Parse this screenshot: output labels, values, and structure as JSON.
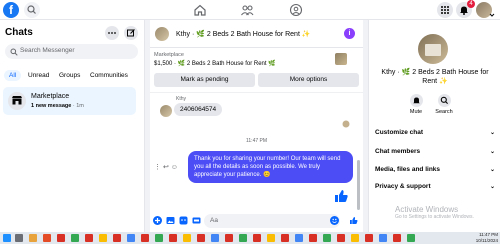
{
  "topbar": {
    "logo_letter": "f",
    "notification_count": "4"
  },
  "sidebar": {
    "title": "Chats",
    "search_placeholder": "Search Messenger",
    "filters": [
      "All",
      "Unread",
      "Groups",
      "Communities"
    ],
    "chat_item": {
      "name": "Marketplace",
      "preview": "1 new message",
      "time": " · 1m"
    }
  },
  "conversation": {
    "title": "Kthy · 🌿 2 Beds 2 Bath House for Rent ✨",
    "listing_source": "Marketplace",
    "listing_detail": "$1,500 · 🌿 2 Beds 2 Bath House for Rent 🌿",
    "mark_pending_label": "Mark as pending",
    "more_options_label": "More options",
    "sender_label": "Kthy",
    "incoming_message": "2406064574",
    "timestamp": "11:47 PM",
    "outgoing_message": "Thank you for sharing your number!     Our team will send you all the details as soon as possible. We truly appreciate your patience. 😊",
    "composer_placeholder": "Aa"
  },
  "info_panel": {
    "name": "Kthy · 🌿 2 Beds 2 Bath House for Rent ✨",
    "mute_label": "Mute",
    "search_label": "Search",
    "sections": [
      "Customize chat",
      "Chat members",
      "Media, files and links",
      "Privacy & support"
    ]
  },
  "watermark": {
    "line1": "Activate Windows",
    "line2": "Go to Settings to activate Windows."
  },
  "taskbar": {
    "time": "11:47 PM",
    "date": "10/11/2024"
  },
  "colors": {
    "brand_blue": "#1877f2",
    "outgoing_bubble": "#4d4df5",
    "info_purple": "#8a3ffc",
    "badge_red": "#e41e3f"
  }
}
